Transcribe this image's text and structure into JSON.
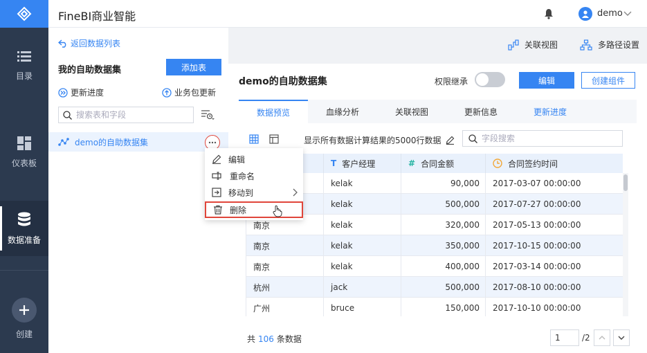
{
  "nav": {
    "items": [
      {
        "label": "目录"
      },
      {
        "label": "仪表板"
      },
      {
        "label": "数据准备"
      },
      {
        "label": "创建"
      }
    ]
  },
  "header": {
    "title": "FineBI商业智能",
    "user": "demo"
  },
  "left": {
    "back_label": "返回数据列表",
    "title": "我的自助数据集",
    "add_table": "添加表",
    "update_progress": "更新进度",
    "package_update": "业务包更新",
    "search_placeholder": "搜索表和字段",
    "dataset_name": "demo的自助数据集"
  },
  "menu": {
    "items": [
      {
        "label": "编辑"
      },
      {
        "label": "重命名"
      },
      {
        "label": "移动到"
      },
      {
        "label": "删除"
      }
    ]
  },
  "topbar": {
    "relation_view": "关联视图",
    "multipath": "多路径设置"
  },
  "main": {
    "title": "demo的自助数据集",
    "perm_label": "权限继承",
    "edit_button": "编辑",
    "create_button": "创建组件",
    "tabs": [
      {
        "label": "数据预览"
      },
      {
        "label": "血缘分析"
      },
      {
        "label": "关联视图"
      },
      {
        "label": "更新信息"
      },
      {
        "label": "更新进度"
      }
    ],
    "preview_text": "显示所有数据计算结果的5000行数据",
    "field_search_placeholder": "字段搜索"
  },
  "table": {
    "columns": [
      {
        "label": "",
        "type": ""
      },
      {
        "label": "客户经理",
        "type": "T"
      },
      {
        "label": "合同金额",
        "type": "#"
      },
      {
        "label": "合同签约时间",
        "type": "time"
      }
    ],
    "rows": [
      [
        "",
        "kelak",
        "90,000",
        "2017-03-07 00:00:00"
      ],
      [
        "",
        "kelak",
        "500,000",
        "2017-07-27 00:00:00"
      ],
      [
        "南京",
        "kelak",
        "320,000",
        "2017-05-13 00:00:00"
      ],
      [
        "南京",
        "kelak",
        "350,000",
        "2017-10-15 00:00:00"
      ],
      [
        "南京",
        "kelak",
        "400,000",
        "2017-03-14 00:00:00"
      ],
      [
        "杭州",
        "jack",
        "500,000",
        "2017-08-10 00:00:00"
      ],
      [
        "广州",
        "bruce",
        "150,000",
        "2017-10-10 00:00:00"
      ]
    ]
  },
  "footer": {
    "prefix": "共",
    "count": "106",
    "suffix": "条数据",
    "page": "1",
    "total": "/2"
  },
  "colors": {
    "accent": "#3685f2",
    "nav_bg": "#2c3a4f",
    "highlight": "#e0453a"
  },
  "icons": [
    "logo-icon",
    "list-icon",
    "dashboard-icon",
    "database-icon",
    "plus-icon",
    "bell-icon",
    "user-icon",
    "chevron-down-icon",
    "back-arrow-icon",
    "progress-icon",
    "upload-icon",
    "search-icon",
    "sort-icon",
    "dataset-icon",
    "more-icon",
    "edit-icon",
    "rename-icon",
    "move-icon",
    "trash-icon",
    "chevron-right-icon",
    "relation-icon",
    "multipath-icon",
    "grid-icon",
    "layout-icon",
    "pencil-icon",
    "chevron-up-icon",
    "clock-icon"
  ]
}
